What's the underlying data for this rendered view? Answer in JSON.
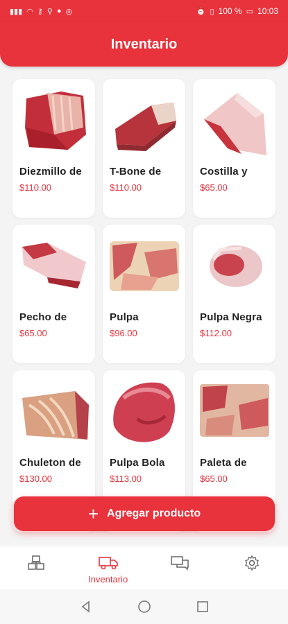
{
  "status_bar": {
    "battery": "100 %",
    "time": "10:03"
  },
  "header": {
    "title": "Inventario"
  },
  "products": [
    {
      "name": "Diezmillo de",
      "price": "$110.00"
    },
    {
      "name": "T-Bone de",
      "price": "$110.00"
    },
    {
      "name": "Costilla y",
      "price": "$65.00"
    },
    {
      "name": "Pecho de",
      "price": "$65.00"
    },
    {
      "name": "Pulpa",
      "price": "$96.00"
    },
    {
      "name": "Pulpa Negra",
      "price": "$112.00"
    },
    {
      "name": "Chuleton de",
      "price": "$130.00"
    },
    {
      "name": "Pulpa Bola",
      "price": "$113.00"
    },
    {
      "name": "Paleta de",
      "price": "$65.00"
    }
  ],
  "add_button": {
    "label": "Agregar producto"
  },
  "bottom_nav": {
    "items": [
      {
        "icon": "boxes-icon",
        "label": ""
      },
      {
        "icon": "truck-icon",
        "label": "Inventario"
      },
      {
        "icon": "chat-icon",
        "label": ""
      },
      {
        "icon": "gear-icon",
        "label": ""
      }
    ]
  },
  "colors": {
    "accent": "#e8323c",
    "background": "#f4f4f4"
  }
}
